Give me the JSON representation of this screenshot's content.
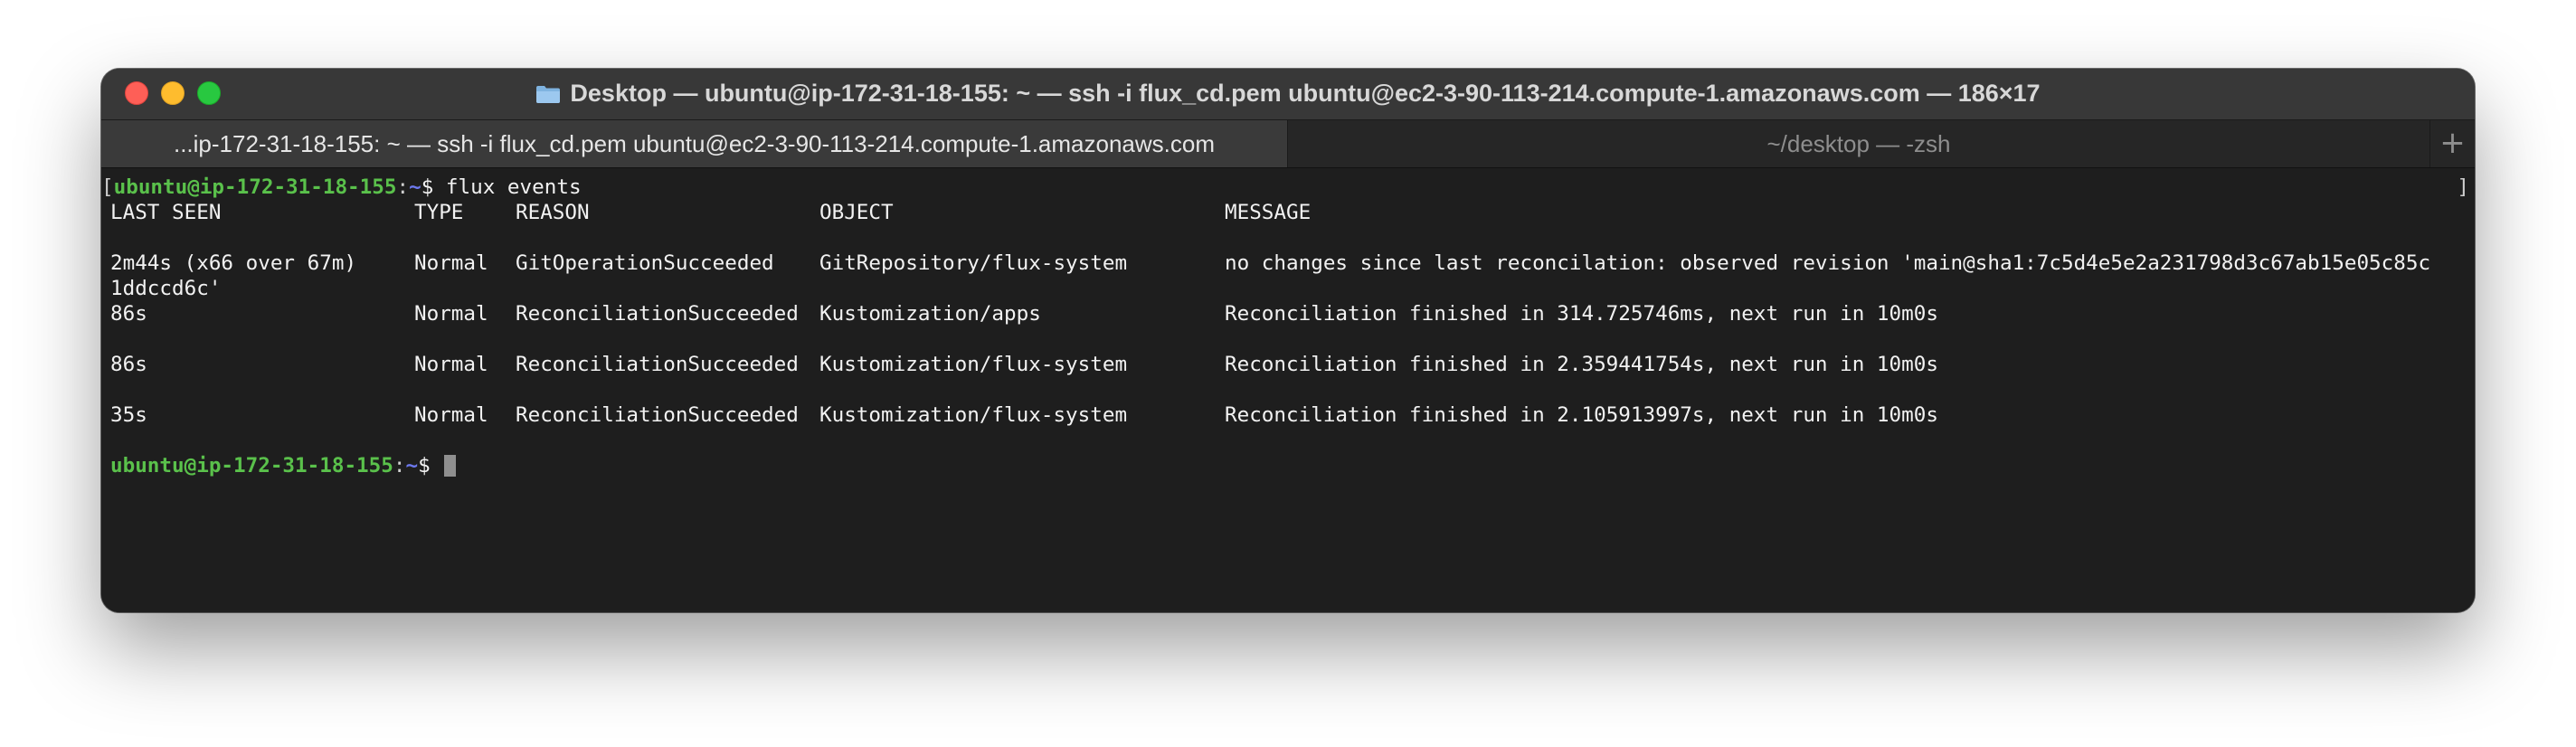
{
  "window": {
    "title": "Desktop — ubuntu@ip-172-31-18-155: ~ — ssh -i flux_cd.pem ubuntu@ec2-3-90-113-214.compute-1.amazonaws.com — 186×17"
  },
  "tabs": [
    {
      "label": "...ip-172-31-18-155: ~ — ssh -i flux_cd.pem ubuntu@ec2-3-90-113-214.compute-1.amazonaws.com",
      "active": true
    },
    {
      "label": "~/desktop — -zsh",
      "active": false
    }
  ],
  "tab_add_label": "+",
  "terminal": {
    "prompt": {
      "open_bracket": "[",
      "user_host": "ubuntu@ip-172-31-18-155",
      "colon": ":",
      "tilde": "~",
      "dollar": "$ ",
      "close_bracket": "]"
    },
    "command": "flux events",
    "headers": {
      "last_seen": "LAST SEEN",
      "type": "TYPE",
      "reason": "REASON",
      "object": "OBJECT",
      "message": "MESSAGE"
    },
    "events": [
      {
        "last_seen": "2m44s (x66 over 67m)",
        "type": "Normal",
        "reason": "GitOperationSucceeded",
        "object": "GitRepository/flux-system",
        "message": "no changes since last reconcilation: observed revision 'main@sha1:7c5d4e5e2a231798d3c67ab15e05c85c",
        "message_wrap": "1ddccd6c'"
      },
      {
        "last_seen": "86s",
        "type": "Normal",
        "reason": "ReconciliationSucceeded",
        "object": "Kustomization/apps",
        "message": "Reconciliation finished in 314.725746ms, next run in 10m0s"
      },
      {
        "last_seen": "86s",
        "type": "Normal",
        "reason": "ReconciliationSucceeded",
        "object": "Kustomization/flux-system",
        "message": "Reconciliation finished in 2.359441754s, next run in 10m0s"
      },
      {
        "last_seen": "35s",
        "type": "Normal",
        "reason": "ReconciliationSucceeded",
        "object": "Kustomization/flux-system",
        "message": "Reconciliation finished in 2.105913997s, next run in 10m0s"
      }
    ]
  },
  "colors": {
    "prompt_green": "#5ac14b",
    "prompt_tilde": "#6d79ef",
    "terminal_bg": "#1e1e1e",
    "titlebar_bg": "#383838"
  },
  "icons": {
    "title": "folder-icon",
    "lights": [
      "close-icon",
      "minimize-icon",
      "zoom-icon"
    ]
  }
}
